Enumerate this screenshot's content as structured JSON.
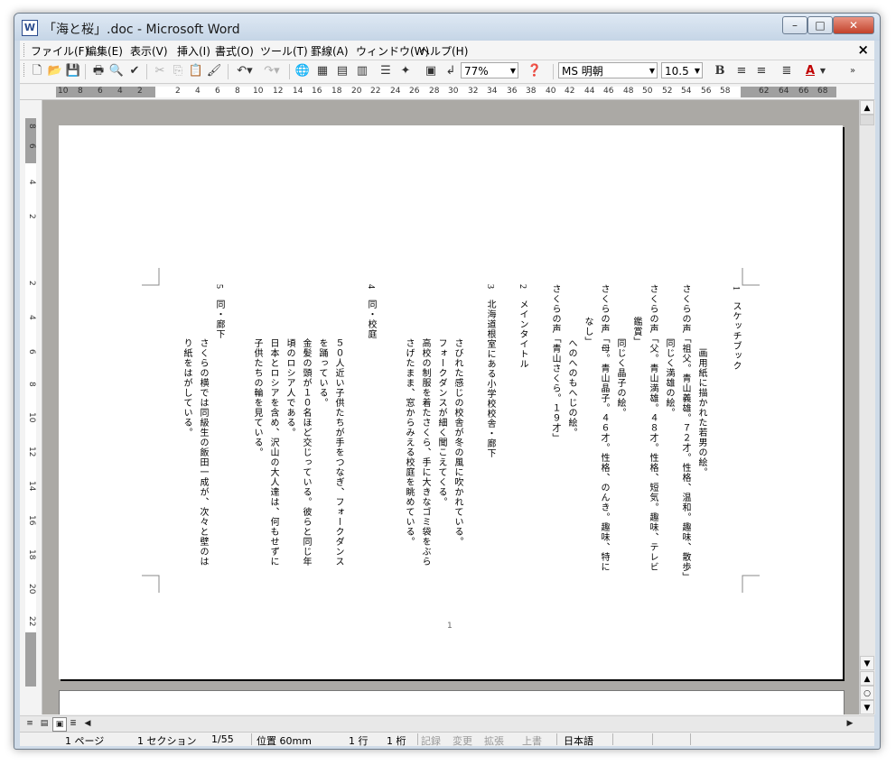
{
  "window": {
    "title": "「海と桜」.doc - Microsoft Word",
    "controls": [
      "–",
      "□",
      "✕"
    ]
  },
  "menu": [
    "ファイル(F)",
    "編集(E)",
    "表示(V)",
    "挿入(I)",
    "書式(O)",
    "ツール(T)",
    "罫線(A)",
    "ウィンドウ(W)",
    "ヘルプ(H)"
  ],
  "doc_close": "×",
  "toolbar": {
    "zoom": "77%",
    "font": "MS 明朝",
    "size": "10.5",
    "bold": "B",
    "font_color": "A",
    "icons": [
      "new-icon",
      "open-icon",
      "save-icon",
      "print-icon",
      "print-preview-icon",
      "spelling-icon",
      "cut-icon",
      "copy-icon",
      "paste-icon",
      "format-painter-icon",
      "undo-icon",
      "redo-icon",
      "hyperlink-icon",
      "tables-borders-icon",
      "insert-table-icon",
      "insert-excel-icon",
      "columns-icon",
      "drawing-icon",
      "document-map-icon",
      "show-hide-icon",
      "help-icon"
    ]
  },
  "ruler": {
    "left_ticks": [
      "10",
      "8",
      "6",
      "4",
      "2"
    ],
    "ticks": [
      "2",
      "4",
      "6",
      "8",
      "10",
      "12",
      "14",
      "16",
      "18",
      "20",
      "22",
      "24",
      "26",
      "28",
      "30",
      "32",
      "34",
      "36",
      "38",
      "40",
      "42",
      "44",
      "46",
      "48",
      "50",
      "52",
      "54",
      "56",
      "58"
    ],
    "right_ticks": [
      "62",
      "64",
      "66",
      "68"
    ],
    "vertical_ticks": [
      "8",
      "6",
      "4",
      "2",
      "2",
      "4",
      "6",
      "8",
      "10",
      "12",
      "14",
      "16",
      "18",
      "20",
      "22"
    ]
  },
  "document": {
    "page_number": "1",
    "columns": [
      "1　スケッチブック",
      "　画用紙に描かれた若男の絵。",
      "さくらの声「祖父。青山義雄。７２才。性格、温和。趣味、散歩」",
      "同じく満雄の絵。",
      "さくらの声「父。青山満雄。４８才。性格、短気。趣味、テレビ",
      "鑑賞」",
      "同じく晶子の絵。",
      "さくらの声「母。青山晶子。４６才。性格、のんき。趣味、特に",
      "なし」",
      "へのへのもへじの絵。",
      "さくらの声「青山さくら。１９才」",
      "2　メインタイトル",
      "3　北海道根室にある小学校校舎・廊下",
      "さびれた感じの校舎が冬の風に吹かれている。",
      "フォークダンスが細く聞こえてくる。",
      "高校の制服を着たさくら、手に大きなゴミ袋をぶら",
      "さげたまま、窓からみえる校庭を眺めている。",
      "4　同・校庭",
      "５０人近い子供たちが手をつなぎ、フォークダンス",
      "を踊っている。",
      "金髪の頭が１０名ほど交じっている。彼らと同じ年",
      "頃のロシア人である。",
      "日本とロシアを含め、沢山の大人達は、何もせずに",
      "子供たちの輪を見ている。",
      "5　同・廊下",
      "さくらの横では同級生の飯田一成が、次々と壁のは",
      "り紙をはがしている。"
    ]
  },
  "view_buttons": [
    "normal-view",
    "web-layout-view",
    "print-layout-view",
    "outline-view"
  ],
  "status": {
    "page": "1 ページ",
    "section": "1 セクション",
    "count": "1/55",
    "position": "位置 60mm",
    "line": "1 行",
    "col": "1 桁",
    "rec": "記録",
    "trk": "変更",
    "ext": "拡張",
    "ovr": "上書",
    "lang": "日本語"
  }
}
